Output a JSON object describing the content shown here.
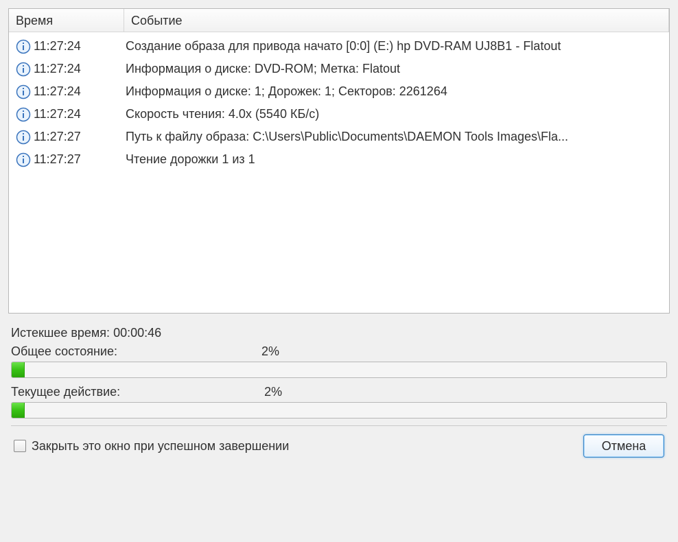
{
  "log": {
    "headers": {
      "time": "Время",
      "event": "Событие"
    },
    "rows": [
      {
        "time": "11:27:24",
        "event": "Создание образа для привода начато [0:0] (E:) hp DVD-RAM UJ8B1 - Flatout"
      },
      {
        "time": "11:27:24",
        "event": "Информация о диске: DVD-ROM; Метка: Flatout"
      },
      {
        "time": "11:27:24",
        "event": "Информация о диске: 1; Дорожек: 1; Секторов: 2261264"
      },
      {
        "time": "11:27:24",
        "event": "Скорость чтения: 4.0x (5540 КБ/с)"
      },
      {
        "time": "11:27:27",
        "event": "Путь к файлу образа: C:\\Users\\Public\\Documents\\DAEMON Tools Images\\Fla..."
      },
      {
        "time": "11:27:27",
        "event": "Чтение дорожки 1 из 1"
      }
    ]
  },
  "status": {
    "elapsed_label": "Истекшее время:",
    "elapsed_value": "00:00:46",
    "overall_label": "Общее состояние:",
    "overall_percent_text": "2%",
    "overall_percent": 2,
    "current_label": "Текущее действие:",
    "current_percent_text": "2%",
    "current_percent": 2
  },
  "footer": {
    "close_on_success_label": "Закрыть это окно при успешном завершении",
    "cancel_label": "Отмена"
  }
}
